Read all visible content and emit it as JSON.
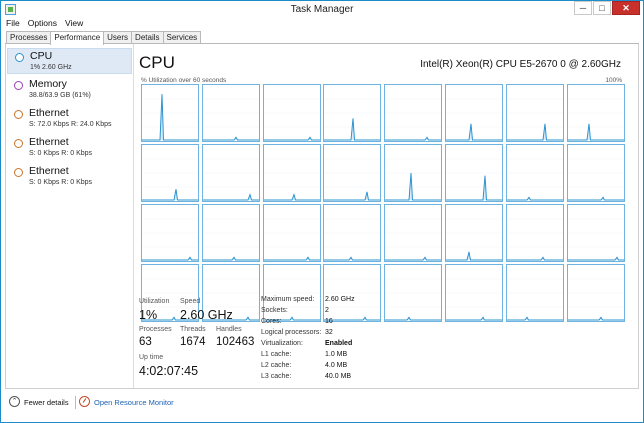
{
  "window": {
    "title": "Task Manager",
    "controls": [
      "─",
      "□",
      "✕"
    ]
  },
  "menu": [
    "File",
    "Options",
    "View"
  ],
  "tabs": [
    {
      "label": "Processes",
      "active": false
    },
    {
      "label": "Performance",
      "active": true
    },
    {
      "label": "Users",
      "active": false
    },
    {
      "label": "Details",
      "active": false
    },
    {
      "label": "Services",
      "active": false
    }
  ],
  "sidebar": {
    "items": [
      {
        "name": "CPU",
        "detail": "1% 2.60 GHz",
        "color": "#2b93d1",
        "selected": true
      },
      {
        "name": "Memory",
        "detail": "38.8/63.9 GB (61%)",
        "color": "#9a3fb8",
        "selected": false
      },
      {
        "name": "Ethernet",
        "detail": "S: 72.0 Kbps R: 24.0 Kbps",
        "color": "#c9752b",
        "selected": false
      },
      {
        "name": "Ethernet",
        "detail": "S: 0 Kbps R: 0 Kbps",
        "color": "#c9752b",
        "selected": false
      },
      {
        "name": "Ethernet",
        "detail": "S: 0 Kbps R: 0 Kbps",
        "color": "#c9752b",
        "selected": false
      }
    ]
  },
  "main": {
    "title": "CPU",
    "model": "Intel(R) Xeon(R) CPU E5-2670 0 @ 2.60GHz",
    "graph_caption": "% Utilization over 60 seconds",
    "graph_max": "100%",
    "graph_color": "#2b93d1",
    "graph_spikes": [
      0.85,
      0.05,
      0.05,
      0.4,
      0.05,
      0.3,
      0.3,
      0.3,
      0.2,
      0.1,
      0.1,
      0.15,
      0.5,
      0.45,
      0.05,
      0.05,
      0.05,
      0.05,
      0.05,
      0.05,
      0.05,
      0.15,
      0.05,
      0.05,
      0.05,
      0.05,
      0.05,
      0.05,
      0.05,
      0.05,
      0.05,
      0.05
    ]
  },
  "stats": {
    "utilization_label": "Utilization",
    "utilization": "1%",
    "speed_label": "Speed",
    "speed": "2.60 GHz",
    "processes_label": "Processes",
    "processes": "63",
    "threads_label": "Threads",
    "threads": "1674",
    "handles_label": "Handles",
    "handles": "102463",
    "uptime_label": "Up time",
    "uptime": "4:02:07:45"
  },
  "specs": [
    {
      "key": "Maximum speed:",
      "value": "2.60 GHz"
    },
    {
      "key": "Sockets:",
      "value": "2"
    },
    {
      "key": "Cores:",
      "value": "16"
    },
    {
      "key": "Logical processors:",
      "value": "32"
    },
    {
      "key": "Virtualization:",
      "value": "Enabled"
    },
    {
      "key": "L1 cache:",
      "value": "1.0 MB"
    },
    {
      "key": "L2 cache:",
      "value": "4.0 MB"
    },
    {
      "key": "L3 cache:",
      "value": "40.0 MB"
    }
  ],
  "footer": {
    "fewer_details": "Fewer details",
    "open_monitor": "Open Resource Monitor"
  }
}
